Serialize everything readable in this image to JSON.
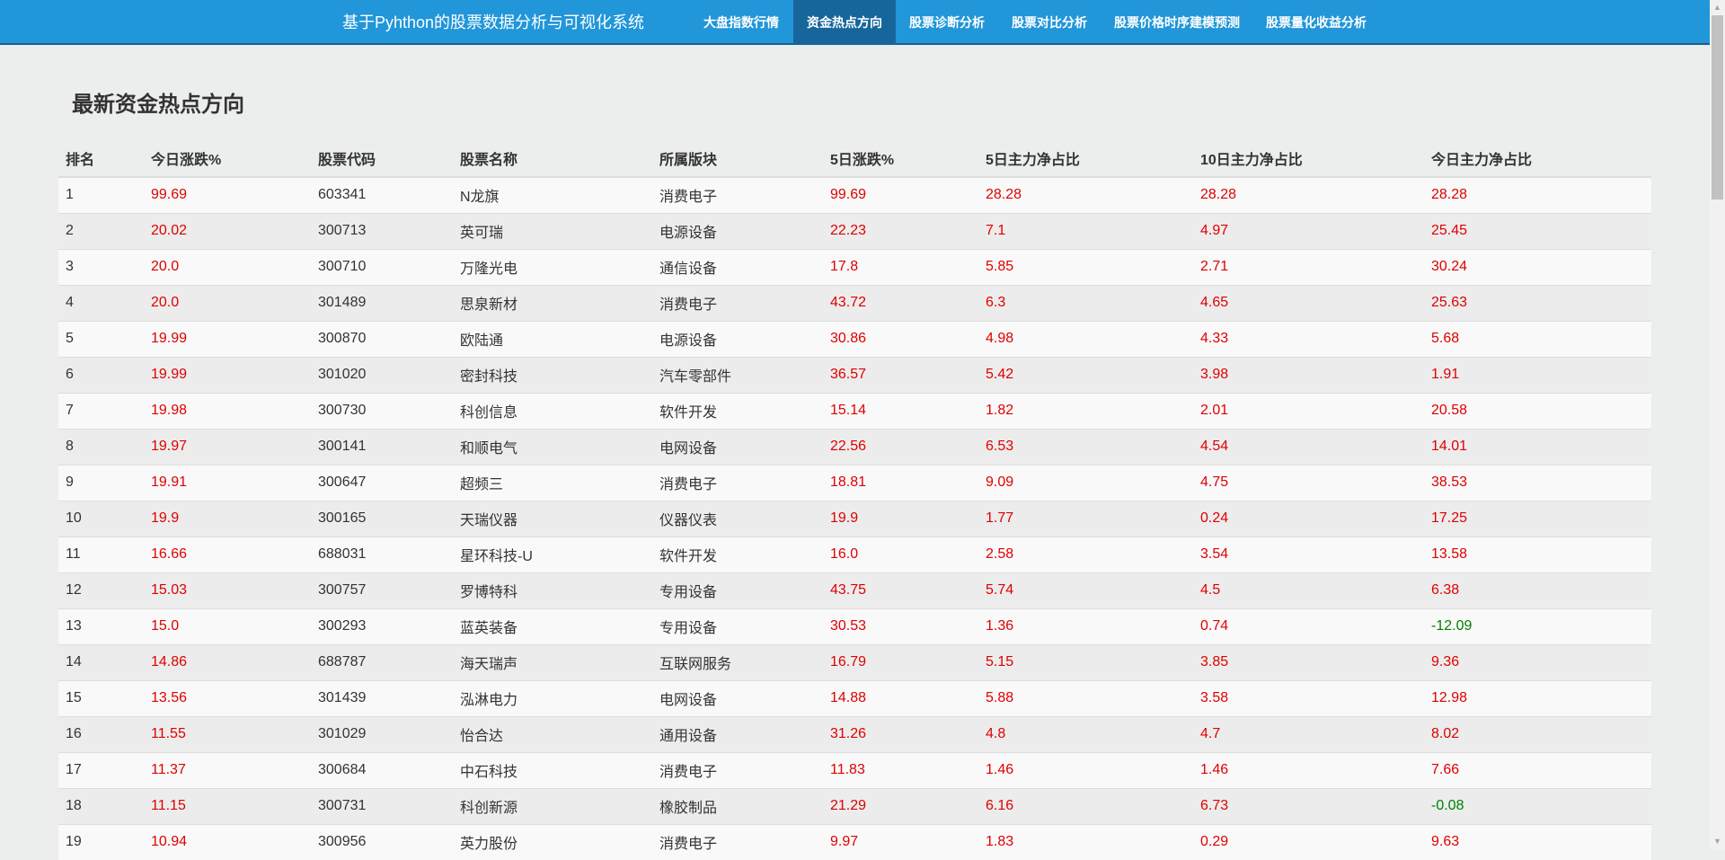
{
  "navbar": {
    "brand": "基于Pyhthon的股票数据分析与可视化系统",
    "items": [
      {
        "label": "大盘指数行情",
        "active": false
      },
      {
        "label": "资金热点方向",
        "active": true
      },
      {
        "label": "股票诊断分析",
        "active": false
      },
      {
        "label": "股票对比分析",
        "active": false
      },
      {
        "label": "股票价格时序建模预测",
        "active": false
      },
      {
        "label": "股票量化收益分析",
        "active": false
      }
    ]
  },
  "page": {
    "title": "最新资金热点方向"
  },
  "table": {
    "headers": [
      "排名",
      "今日涨跌%",
      "股票代码",
      "股票名称",
      "所属版块",
      "5日涨跌%",
      "5日主力净占比",
      "10日主力净占比",
      "今日主力净占比"
    ],
    "rows": [
      [
        "1",
        "99.69",
        "603341",
        "N龙旗",
        "消费电子",
        "99.69",
        "28.28",
        "28.28",
        "28.28"
      ],
      [
        "2",
        "20.02",
        "300713",
        "英可瑞",
        "电源设备",
        "22.23",
        "7.1",
        "4.97",
        "25.45"
      ],
      [
        "3",
        "20.0",
        "300710",
        "万隆光电",
        "通信设备",
        "17.8",
        "5.85",
        "2.71",
        "30.24"
      ],
      [
        "4",
        "20.0",
        "301489",
        "思泉新材",
        "消费电子",
        "43.72",
        "6.3",
        "4.65",
        "25.63"
      ],
      [
        "5",
        "19.99",
        "300870",
        "欧陆通",
        "电源设备",
        "30.86",
        "4.98",
        "4.33",
        "5.68"
      ],
      [
        "6",
        "19.99",
        "301020",
        "密封科技",
        "汽车零部件",
        "36.57",
        "5.42",
        "3.98",
        "1.91"
      ],
      [
        "7",
        "19.98",
        "300730",
        "科创信息",
        "软件开发",
        "15.14",
        "1.82",
        "2.01",
        "20.58"
      ],
      [
        "8",
        "19.97",
        "300141",
        "和顺电气",
        "电网设备",
        "22.56",
        "6.53",
        "4.54",
        "14.01"
      ],
      [
        "9",
        "19.91",
        "300647",
        "超频三",
        "消费电子",
        "18.81",
        "9.09",
        "4.75",
        "38.53"
      ],
      [
        "10",
        "19.9",
        "300165",
        "天瑞仪器",
        "仪器仪表",
        "19.9",
        "1.77",
        "0.24",
        "17.25"
      ],
      [
        "11",
        "16.66",
        "688031",
        "星环科技-U",
        "软件开发",
        "16.0",
        "2.58",
        "3.54",
        "13.58"
      ],
      [
        "12",
        "15.03",
        "300757",
        "罗博特科",
        "专用设备",
        "43.75",
        "5.74",
        "4.5",
        "6.38"
      ],
      [
        "13",
        "15.0",
        "300293",
        "蓝英装备",
        "专用设备",
        "30.53",
        "1.36",
        "0.74",
        "-12.09"
      ],
      [
        "14",
        "14.86",
        "688787",
        "海天瑞声",
        "互联网服务",
        "16.79",
        "5.15",
        "3.85",
        "9.36"
      ],
      [
        "15",
        "13.56",
        "301439",
        "泓淋电力",
        "电网设备",
        "14.88",
        "5.88",
        "3.58",
        "12.98"
      ],
      [
        "16",
        "11.55",
        "301029",
        "怡合达",
        "通用设备",
        "31.26",
        "4.8",
        "4.7",
        "8.02"
      ],
      [
        "17",
        "11.37",
        "300684",
        "中石科技",
        "消费电子",
        "11.83",
        "1.46",
        "1.46",
        "7.66"
      ],
      [
        "18",
        "11.15",
        "300731",
        "科创新源",
        "橡胶制品",
        "21.29",
        "6.16",
        "6.73",
        "-0.08"
      ],
      [
        "19",
        "10.94",
        "300956",
        "英力股份",
        "消费电子",
        "9.97",
        "1.83",
        "0.29",
        "9.63"
      ]
    ]
  },
  "colors": {
    "navbar": "#2196d9",
    "nav_active": "#16669c",
    "positive": "#e00000",
    "negative": "#008000"
  },
  "icons": {
    "scroll_up": "scroll-up-arrow-icon",
    "scroll_down": "scroll-down-arrow-icon"
  }
}
